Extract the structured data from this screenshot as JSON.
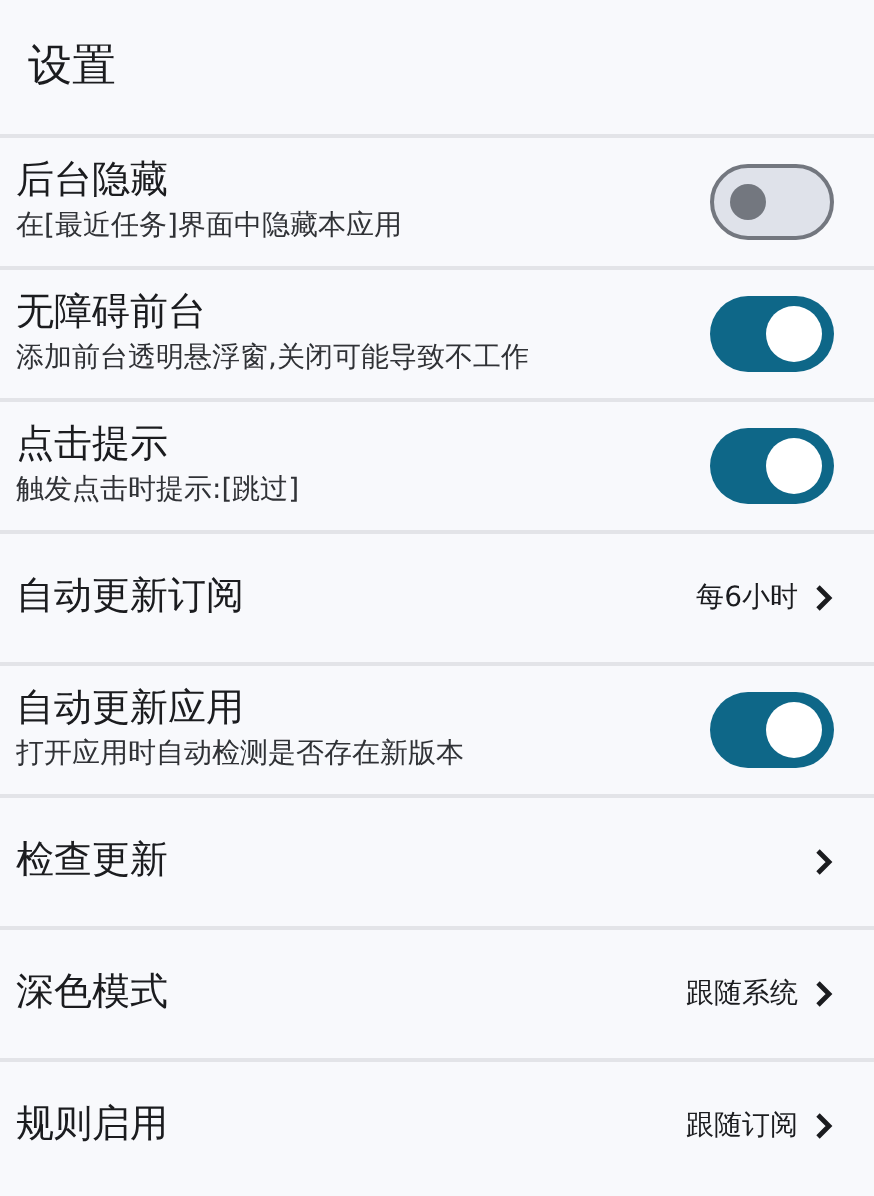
{
  "title": "设置",
  "items": [
    {
      "kind": "toggle",
      "label": "后台隐藏",
      "description": "在[最近任务]界面中隐藏本应用",
      "on": false
    },
    {
      "kind": "toggle",
      "label": "无障碍前台",
      "description": "添加前台透明悬浮窗,关闭可能导致不工作",
      "on": true
    },
    {
      "kind": "toggle",
      "label": "点击提示",
      "description": "触发点击时提示:[跳过]",
      "on": true
    },
    {
      "kind": "link",
      "label": "自动更新订阅",
      "value": "每6小时"
    },
    {
      "kind": "toggle",
      "label": "自动更新应用",
      "description": "打开应用时自动检测是否存在新版本",
      "on": true
    },
    {
      "kind": "link",
      "label": "检查更新"
    },
    {
      "kind": "link",
      "label": "深色模式",
      "value": "跟随系统"
    },
    {
      "kind": "link",
      "label": "规则启用",
      "value": "跟随订阅"
    }
  ]
}
